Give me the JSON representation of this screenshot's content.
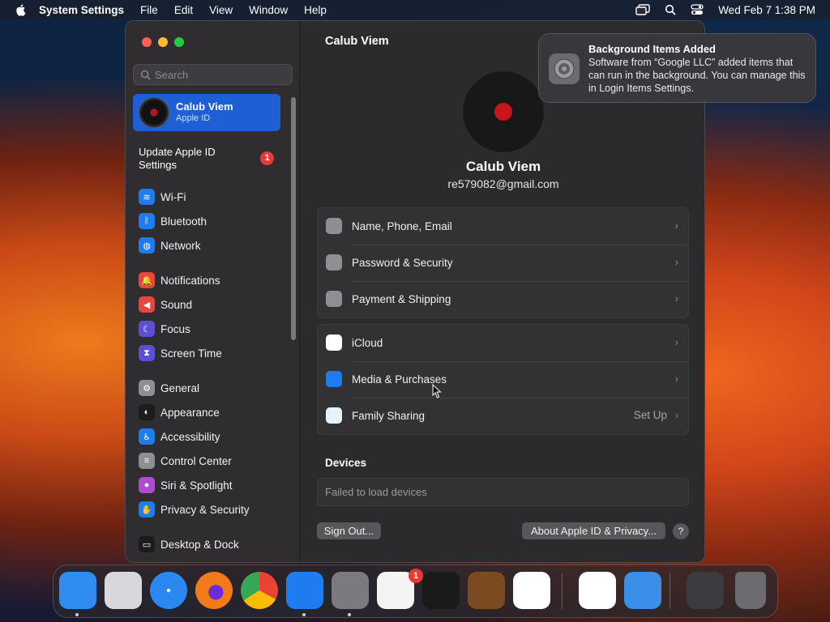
{
  "menubar": {
    "app": "System Settings",
    "items": [
      "File",
      "Edit",
      "View",
      "Window",
      "Help"
    ],
    "clock": "Wed Feb 7  1:38 PM"
  },
  "sidebar": {
    "search_placeholder": "Search",
    "apple_id": {
      "name": "Calub Viem",
      "sub": "Apple ID"
    },
    "update": {
      "label": "Update Apple ID Settings",
      "badge": "1"
    },
    "items": [
      {
        "label": "Wi-Fi",
        "icon": "wifi-icon",
        "color": "#1e7cf0"
      },
      {
        "label": "Bluetooth",
        "icon": "bluetooth-icon",
        "color": "#1e7cf0"
      },
      {
        "label": "Network",
        "icon": "globe-icon",
        "color": "#1e7cf0"
      },
      {
        "label": "Notifications",
        "icon": "bell-icon",
        "color": "#e8453c"
      },
      {
        "label": "Sound",
        "icon": "speaker-icon",
        "color": "#e8453c"
      },
      {
        "label": "Focus",
        "icon": "moon-icon",
        "color": "#5b4fd6"
      },
      {
        "label": "Screen Time",
        "icon": "hourglass-icon",
        "color": "#5b4fd6"
      },
      {
        "label": "General",
        "icon": "gear-icon",
        "color": "#8e8e93"
      },
      {
        "label": "Appearance",
        "icon": "appearance-icon",
        "color": "#1c1c1e"
      },
      {
        "label": "Accessibility",
        "icon": "accessibility-icon",
        "color": "#1e7cf0"
      },
      {
        "label": "Control Center",
        "icon": "switches-icon",
        "color": "#8e8e93"
      },
      {
        "label": "Siri & Spotlight",
        "icon": "siri-icon",
        "color": "#b04ad0"
      },
      {
        "label": "Privacy & Security",
        "icon": "hand-icon",
        "color": "#1e7cf0"
      },
      {
        "label": "Desktop & Dock",
        "icon": "dock-icon",
        "color": "#1c1c1e"
      }
    ]
  },
  "main": {
    "title": "Calub Viem",
    "user_name": "Calub Viem",
    "email": "re579082@gmail.com",
    "group1": [
      {
        "label": "Name, Phone, Email",
        "icon": "person-icon",
        "color": "#8e8e93"
      },
      {
        "label": "Password & Security",
        "icon": "lock-icon",
        "color": "#8e8e93"
      },
      {
        "label": "Payment & Shipping",
        "icon": "card-icon",
        "color": "#8e8e93"
      }
    ],
    "group2": [
      {
        "label": "iCloud",
        "icon": "cloud-icon",
        "color": "#ffffff"
      },
      {
        "label": "Media & Purchases",
        "icon": "app-store-icon",
        "color": "#1e7cf0"
      },
      {
        "label": "Family Sharing",
        "icon": "family-icon",
        "color": "#e7f0fb",
        "value": "Set Up"
      }
    ],
    "devices_heading": "Devices",
    "devices_status": "Failed to load devices",
    "sign_out": "Sign Out...",
    "about": "About Apple ID & Privacy...",
    "help": "?"
  },
  "notification": {
    "title": "Background Items Added",
    "body": "Software from “Google LLC” added items that can run in the background. You can manage this in Login Items Settings."
  },
  "dock": {
    "settings_badge": "1",
    "apps": [
      {
        "name": "finder-icon",
        "color": "#2f8cf0"
      },
      {
        "name": "launchpad-icon",
        "color": "#d8d8dc"
      },
      {
        "name": "safari-icon",
        "color": "#2b88f0"
      },
      {
        "name": "firefox-icon",
        "color": "#f27a1b"
      },
      {
        "name": "chrome-icon",
        "color": "#ffffff"
      },
      {
        "name": "app-store-icon",
        "color": "#1e7cf0"
      },
      {
        "name": "system-settings-icon",
        "color": "#7a7a80"
      },
      {
        "name": "textedit-icon",
        "color": "#f4f4f4"
      },
      {
        "name": "terminal-icon",
        "color": "#1a1a1a"
      },
      {
        "name": "garageband-icon",
        "color": "#7a4a20"
      },
      {
        "name": "vscode-icon",
        "color": "#ffffff"
      },
      {
        "name": "visual-studio-icon",
        "color": "#ffffff"
      },
      {
        "name": "weather-icon",
        "color": "#3a8fe6"
      },
      {
        "name": "downloads-stack-icon",
        "color": "#3c3c40"
      },
      {
        "name": "trash-icon",
        "color": "#6b6b70"
      }
    ]
  }
}
